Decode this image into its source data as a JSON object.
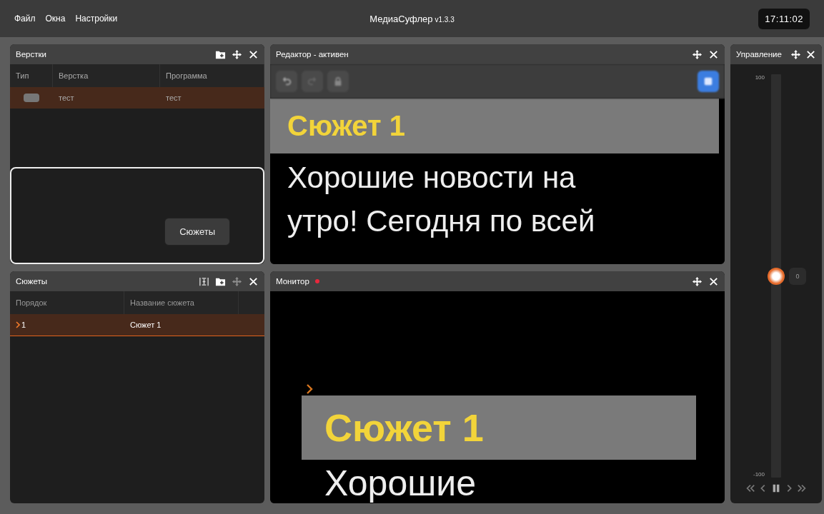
{
  "menu": [
    "Файл",
    "Окна",
    "Настройки"
  ],
  "app_title": {
    "name": "МедиаСуфлер",
    "version": "v1.3.3"
  },
  "clock": "17:11:02",
  "layouts_panel": {
    "title": "Верстки",
    "columns": [
      "Тип",
      "Верстка",
      "Программа"
    ],
    "rows": [
      {
        "cells": [
          "",
          "тест",
          "тест"
        ],
        "selected": true
      }
    ],
    "drop_preview": {
      "button": "Сюжеты"
    }
  },
  "stories_panel": {
    "title": "Сюжеты",
    "columns": [
      "Порядок",
      "Название сюжета"
    ],
    "rows": [
      {
        "cells": [
          "1",
          "Сюжет 1"
        ],
        "selected": true,
        "current": true
      }
    ]
  },
  "editor_panel": {
    "title": "Редактор - активен",
    "title_block": "Сюжет 1",
    "lines": [
      "Хорошие новости на",
      "утро! Сегодня по всей"
    ]
  },
  "monitor_panel": {
    "title": "Монитор",
    "live": true,
    "title_block": "Сюжет 1",
    "current": true,
    "lines": [
      "Хорошие"
    ]
  },
  "control_panel": {
    "title": "Управление",
    "max": "100",
    "min": "-100",
    "reset": "0",
    "speed": {
      "level": 0.5
    }
  }
}
